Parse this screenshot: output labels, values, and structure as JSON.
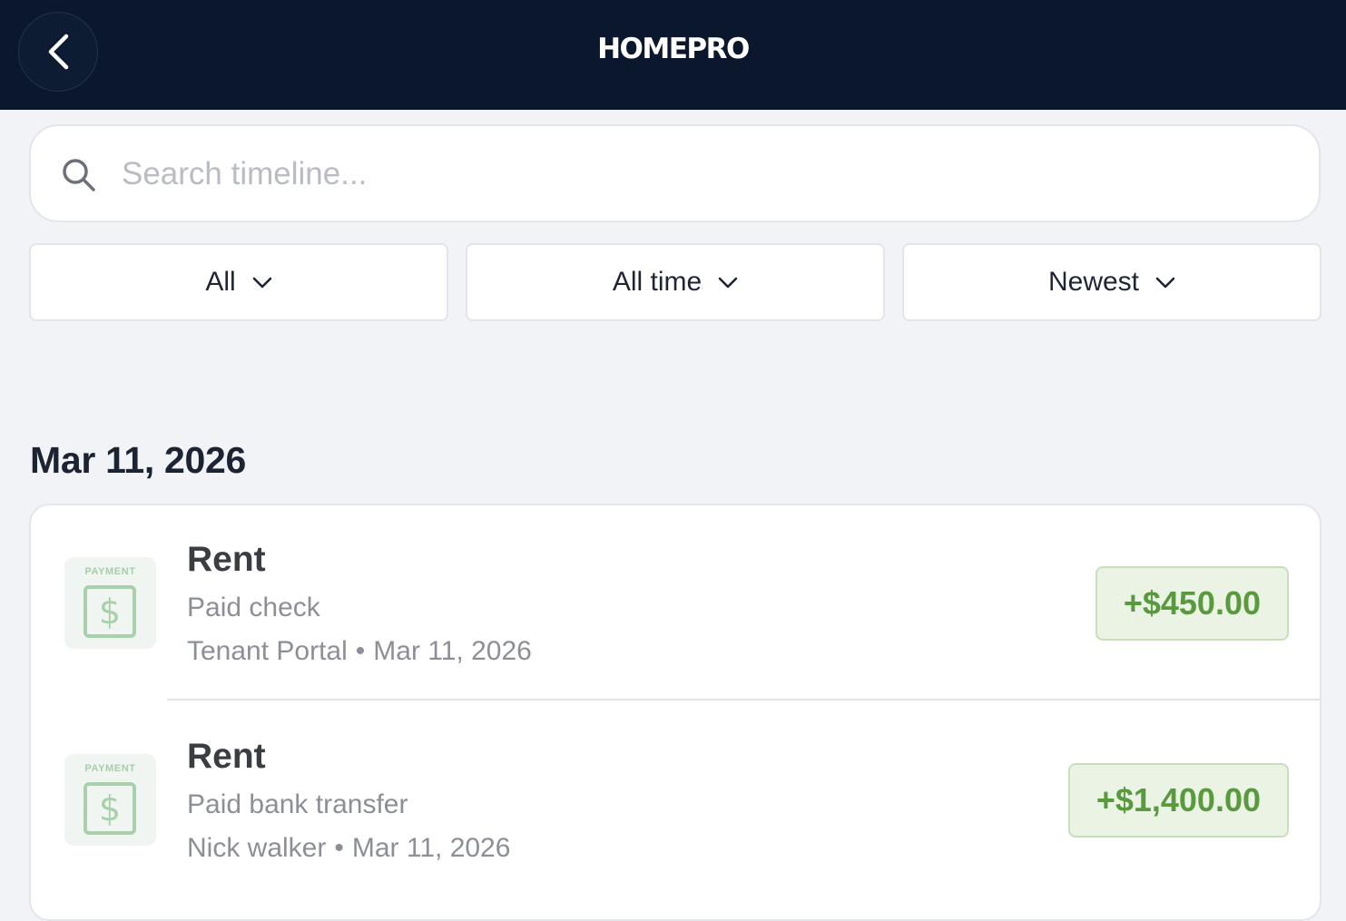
{
  "header": {
    "title": "HOMEPRO",
    "back_icon": "chevron-left-icon"
  },
  "search": {
    "placeholder": "Search timeline...",
    "value": "",
    "icon": "search-icon"
  },
  "filters": [
    {
      "label": "All",
      "icon": "chevron-down-icon"
    },
    {
      "label": "All time",
      "icon": "chevron-down-icon"
    },
    {
      "label": "Newest",
      "icon": "chevron-down-icon"
    }
  ],
  "timeline": {
    "date_heading": "Mar 11, 2026",
    "entries": [
      {
        "badge_label": "PAYMENT",
        "badge_symbol": "$",
        "title": "Rent",
        "subtitle": "Paid check",
        "source": "Tenant Portal",
        "separator": "•",
        "date": "Mar 11, 2026",
        "amount": "+$450.00"
      },
      {
        "badge_label": "PAYMENT",
        "badge_symbol": "$",
        "title": "Rent",
        "subtitle": "Paid bank transfer",
        "source": "Nick walker",
        "separator": "•",
        "date": "Mar 11, 2026",
        "amount": "+$1,400.00"
      }
    ]
  },
  "colors": {
    "header_bg": "#0b172c",
    "page_bg": "#f2f3f7",
    "amount_text": "#5a9a3f",
    "amount_bg": "#ebf3e4",
    "payment_icon": "#a8d1ab"
  }
}
